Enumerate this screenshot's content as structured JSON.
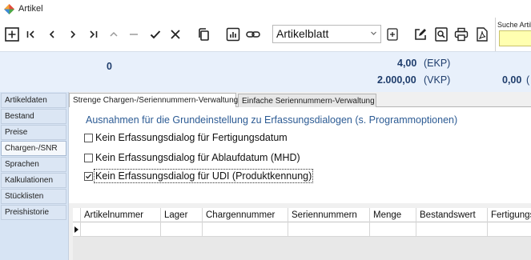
{
  "window": {
    "title": "Artikel",
    "app_icon": "colorful-diamond-icon"
  },
  "toolbar": {
    "buttons": [
      {
        "icon": "add-icon"
      },
      {
        "icon": "first-record-icon"
      },
      {
        "icon": "previous-record-icon"
      },
      {
        "icon": "next-record-icon"
      },
      {
        "icon": "last-record-icon"
      },
      {
        "icon": "up-icon"
      },
      {
        "icon": "minus-icon"
      },
      {
        "icon": "confirm-check-icon"
      },
      {
        "icon": "cancel-x-icon"
      },
      {
        "icon": "copy-icon"
      },
      {
        "icon": "report-chart-icon"
      },
      {
        "icon": "link-icon"
      }
    ],
    "report_combo": {
      "value": "Artikelblatt"
    },
    "right_buttons": [
      {
        "icon": "add-small-icon"
      },
      {
        "icon": "edit-icon"
      },
      {
        "icon": "preview-icon"
      },
      {
        "icon": "print-icon"
      },
      {
        "icon": "pdf-icon"
      }
    ],
    "search": {
      "label": "Suche Artikel",
      "value": ""
    }
  },
  "summary": {
    "stock": "0",
    "ekp_value": "4,00",
    "ekp_label": "(EKP)",
    "vkp_value": "2.000,00",
    "vkp_label": "(VKP)",
    "right_value": "0,00",
    "right_label": "("
  },
  "nav": {
    "items": [
      {
        "label": "Artikeldaten"
      },
      {
        "label": "Bestand"
      },
      {
        "label": "Preise"
      },
      {
        "label": "Chargen-/SNR",
        "active": true
      },
      {
        "label": "Sprachen"
      },
      {
        "label": "Kalkulationen"
      },
      {
        "label": "Stücklisten"
      },
      {
        "label": "Preishistorie"
      }
    ]
  },
  "tabs": [
    {
      "label": "Strenge Chargen-/Seriennummern-Verwaltung",
      "active": true
    },
    {
      "label": "Einfache Seriennummern-Verwaltung",
      "active": false
    }
  ],
  "panel": {
    "heading": "Ausnahmen für die Grundeinstellung zu Erfassungsdialogen (s. Programmoptionen)",
    "checkboxes": [
      {
        "label": "Kein Erfassungsdialog für Fertigungsdatum",
        "checked": false
      },
      {
        "label": "Kein Erfassungsdialog für Ablaufdatum (MHD)",
        "checked": false
      },
      {
        "label": "Kein Erfassungsdialog für UDI (Produktkennung)",
        "checked": true
      }
    ]
  },
  "grid": {
    "columns": [
      "Artikelnummer",
      "Lager",
      "Chargennummer",
      "Seriennummern",
      "Menge",
      "Bestandswert",
      "Fertigungs"
    ],
    "rows": [
      [
        "",
        "",
        "",
        "",
        "",
        "",
        ""
      ]
    ]
  }
}
